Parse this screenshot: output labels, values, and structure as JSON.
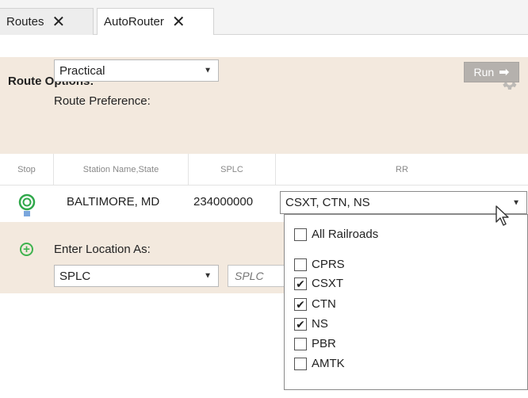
{
  "tabs": [
    {
      "label": "Routes",
      "close_icon": "close-icon"
    },
    {
      "label": "AutoRouter",
      "close_icon": "close-icon"
    }
  ],
  "route_options": {
    "title": "Route Options:",
    "preference_label": "Route Preference:",
    "preference_value": "Practical",
    "settings_icon": "gear-icon",
    "run_label": "Run",
    "run_icon": "arrow-right-icon"
  },
  "columns": [
    "Stop",
    "Station Name,State",
    "SPLC",
    "RR"
  ],
  "stop_row": {
    "icon": "origin-marker-icon",
    "station": "BALTIMORE, MD",
    "splc": "234000000",
    "rr_value": "CSXT, CTN, NS"
  },
  "add_stop": {
    "icon": "add-icon",
    "label": "Enter Location As:",
    "type_value": "SPLC",
    "splc_placeholder": "SPLC"
  },
  "railroad_dropdown": {
    "all_label": "All Railroads",
    "all_checked": false,
    "items": [
      {
        "label": "CPRS",
        "checked": false
      },
      {
        "label": "CSXT",
        "checked": true
      },
      {
        "label": "CTN",
        "checked": true
      },
      {
        "label": "NS",
        "checked": true
      },
      {
        "label": "PBR",
        "checked": false
      },
      {
        "label": "AMTK",
        "checked": false
      }
    ]
  },
  "colors": {
    "panel_bg": "#f3e9de",
    "run_button_bg": "#b5b1ad",
    "origin_marker": "#2fa84a",
    "add_icon": "#3fb34f"
  }
}
